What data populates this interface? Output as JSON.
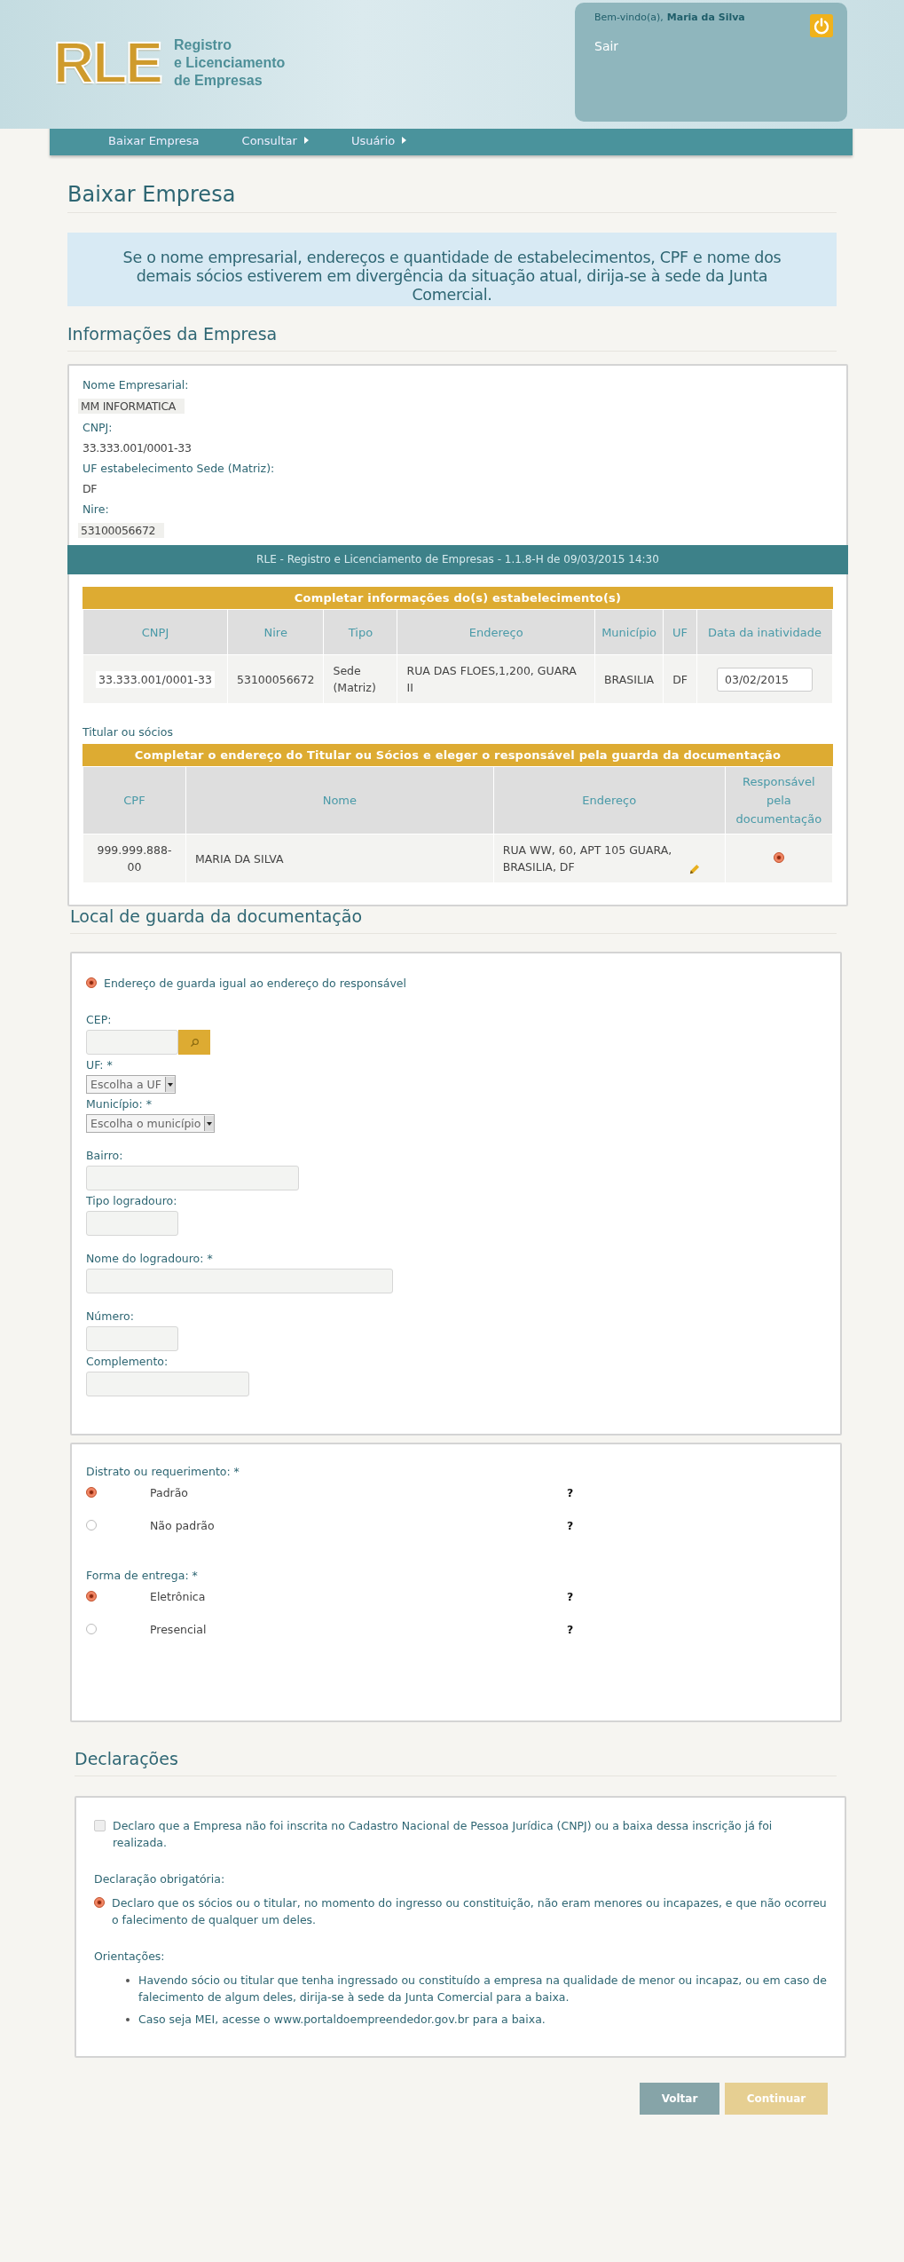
{
  "header": {
    "logo": "RLE",
    "subtitle": [
      "Registro",
      "e Licenciamento",
      "de Empresas"
    ],
    "greeting": "Bem-vindo(a),",
    "user": "Maria da Silva",
    "logout": "Sair"
  },
  "nav": [
    {
      "label": "Baixar Empresa",
      "submenu": false
    },
    {
      "label": "Consultar",
      "submenu": true
    },
    {
      "label": "Usuário",
      "submenu": true
    }
  ],
  "page_title": "Baixar Empresa",
  "notice": "Se o nome empresarial, endereços e quantidade de estabelecimentos, CPF e nome dos demais sócios estiverem em divergência da situação atual, dirija-se à sede da Junta Comercial.",
  "company": {
    "heading": "Informações da Empresa",
    "fields": [
      {
        "label": "Nome Empresarial:",
        "value": "MM INFORMATICA",
        "boxed": true
      },
      {
        "label": "CNPJ:",
        "value": "33.333.001/0001-33",
        "boxed": false
      },
      {
        "label": "UF estabelecimento Sede (Matriz):",
        "value": "DF",
        "boxed": false
      },
      {
        "label": "Nire:",
        "value": "53100056672",
        "boxed": true
      }
    ]
  },
  "footer_bar": "RLE - Registro e Licenciamento de Empresas - 1.1.8-H de 09/03/2015 14:30",
  "establishments": {
    "title": "Completar informações do(s) estabelecimento(s)",
    "columns": [
      "CNPJ",
      "Nire",
      "Tipo",
      "Endereço",
      "Município",
      "UF",
      "Data da inatividade"
    ],
    "rows": [
      {
        "cnpj": "33.333.001/0001-33",
        "nire": "53100056672",
        "tipo": "Sede (Matriz)",
        "endereco": "RUA DAS FLOES,1,200, GUARA II",
        "municipio": "BRASILIA",
        "uf": "DF",
        "date": "03/02/2015"
      }
    ]
  },
  "partners": {
    "label": "Titular ou sócios",
    "title": "Completar o endereço do Titular ou Sócios e eleger o responsável pela guarda da documentação",
    "columns": [
      "CPF",
      "Nome",
      "Endereço",
      "Responsável pela documentação"
    ],
    "rows": [
      {
        "cpf": "999.999.888-00",
        "name": "MARIA DA SILVA",
        "address": "RUA WW, 60, APT 105 GUARA, BRASILIA, DF",
        "selected": true
      }
    ]
  },
  "storage": {
    "heading": "Local de guarda da documentação",
    "same_address": {
      "label": "Endereço de guarda igual ao endereço do responsável",
      "selected": true
    },
    "fields": [
      {
        "kind": "cep",
        "label": "CEP:"
      },
      {
        "kind": "select",
        "label": "UF: *",
        "value": "Escolha a UF"
      },
      {
        "kind": "select",
        "label": "Município: *",
        "value": "Escolha o município"
      },
      {
        "kind": "text",
        "label": "Bairro:"
      },
      {
        "kind": "text",
        "label": "Tipo logradouro:"
      },
      {
        "kind": "text",
        "label": "Nome do logradouro: *"
      },
      {
        "kind": "text",
        "label": "Número:"
      },
      {
        "kind": "text",
        "label": "Complemento:"
      }
    ]
  },
  "options": [
    {
      "label": "Distrato ou requerimento: *",
      "choices": [
        {
          "label": "Padrão",
          "selected": true,
          "help": "?"
        },
        {
          "label": "Não padrão",
          "selected": false,
          "help": "?"
        }
      ]
    },
    {
      "label": "Forma de entrega: *",
      "choices": [
        {
          "label": "Eletrônica",
          "selected": true,
          "help": "?"
        },
        {
          "label": "Presencial",
          "selected": false,
          "help": "?"
        }
      ]
    }
  ],
  "declarations": {
    "heading": "Declarações",
    "cnpj_check": {
      "label": "Declaro que a Empresa não foi inscrita no Cadastro Nacional de Pessoa Jurídica (CNPJ) ou a baixa dessa inscrição já foi realizada.",
      "checked": false
    },
    "mandatory_label": "Declaração obrigatória:",
    "mandatory": {
      "label": "Declaro que os sócios ou o titular, no momento do ingresso ou constituição, não eram menores ou incapazes, e que não ocorreu o falecimento de qualquer um deles.",
      "selected": true
    },
    "guidance_label": "Orientações:",
    "guidance": [
      "Havendo sócio ou titular que tenha ingressado ou constituído a empresa na qualidade de menor ou incapaz, ou em caso de falecimento de algum deles, dirija-se à sede da Junta Comercial para a baixa.",
      "Caso seja MEI, acesse o www.portaldoempreendedor.gov.br para a baixa."
    ]
  },
  "buttons": [
    {
      "label": "Voltar",
      "disabled": false
    },
    {
      "label": "Continuar",
      "disabled": true
    }
  ]
}
